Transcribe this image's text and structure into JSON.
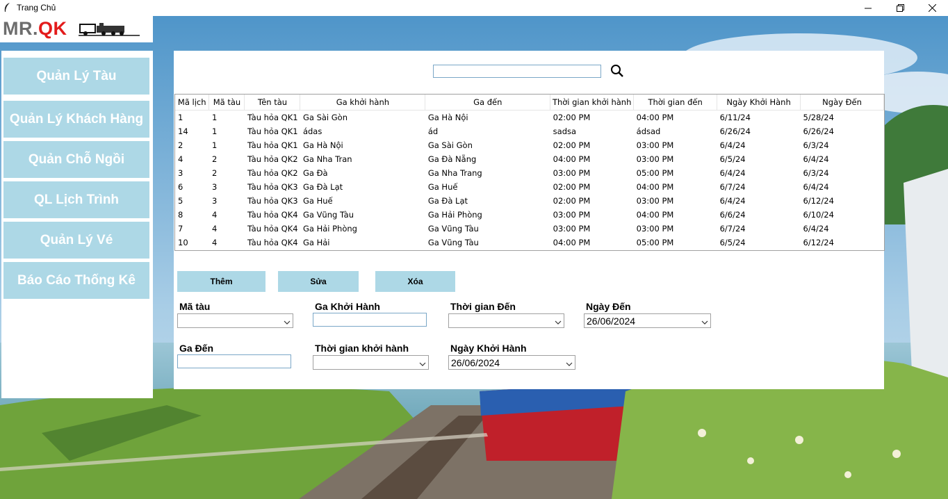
{
  "window": {
    "title": "Trang Chủ"
  },
  "logo": {
    "part1": "MR.",
    "part2": "QK"
  },
  "sidebar": {
    "items": [
      {
        "label": "Quản Lý Tàu"
      },
      {
        "label": "Quản Lý Khách Hàng"
      },
      {
        "label": "Quản Chỗ Ngồi"
      },
      {
        "label": "QL Lịch Trình"
      },
      {
        "label": "Quản Lý Vé"
      },
      {
        "label": "Báo Cáo Thống Kê"
      }
    ]
  },
  "search": {
    "value": "",
    "icon": "search-icon"
  },
  "table": {
    "columns": [
      "Mã lịch",
      "Mã tàu",
      "Tên tàu",
      "Ga khởi hành",
      "Ga đến",
      "Thời gian khởi hành",
      "Thời gian đến",
      "Ngày Khởi Hành",
      "Ngày Đến"
    ],
    "rows": [
      [
        "1",
        "1",
        "Tàu hỏa QK1",
        "Ga Sài Gòn",
        "Ga Hà Nội",
        "02:00 PM",
        "04:00 PM",
        "6/11/24",
        "5/28/24"
      ],
      [
        "14",
        "1",
        "Tàu hỏa QK1",
        "ádas",
        "ád",
        "sadsa",
        "ádsad",
        "6/26/24",
        "6/26/24"
      ],
      [
        "2",
        "1",
        "Tàu hỏa QK1",
        "Ga Hà Nội",
        "Ga Sài Gòn",
        "02:00 PM",
        "03:00 PM",
        "6/4/24",
        "6/3/24"
      ],
      [
        "4",
        "2",
        "Tàu hỏa QK2",
        "Ga Nha Tran",
        "Ga Đà Nẵng",
        "04:00 PM",
        "03:00 PM",
        "6/5/24",
        "6/4/24"
      ],
      [
        "3",
        "2",
        "Tàu hỏa QK2",
        "Ga Đà",
        "Ga Nha Trang",
        "03:00 PM",
        "05:00 PM",
        "6/4/24",
        "6/3/24"
      ],
      [
        "6",
        "3",
        "Tàu hỏa QK3",
        "Ga Đà Lạt",
        "Ga Huế",
        "02:00 PM",
        "04:00 PM",
        "6/7/24",
        "6/4/24"
      ],
      [
        "5",
        "3",
        "Tàu hỏa QK3",
        "Ga Huế",
        "Ga Đà Lạt",
        "02:00 PM",
        "03:00 PM",
        "6/4/24",
        "6/12/24"
      ],
      [
        "8",
        "4",
        "Tàu hỏa QK4",
        "Ga Vũng Tàu",
        "Ga Hải Phòng",
        "03:00 PM",
        "04:00 PM",
        "6/6/24",
        "6/10/24"
      ],
      [
        "7",
        "4",
        "Tàu hỏa QK4",
        "Ga Hải Phòng",
        "Ga Vũng Tàu",
        "03:00 PM",
        "03:00 PM",
        "6/7/24",
        "6/4/24"
      ],
      [
        "10",
        "4",
        "Tàu hỏa QK4",
        "Ga Hải",
        "Ga Vũng Tàu",
        "04:00 PM",
        "05:00 PM",
        "6/5/24",
        "6/12/24"
      ]
    ]
  },
  "actions": {
    "add": "Thêm",
    "edit": "Sửa",
    "delete": "Xóa"
  },
  "form": {
    "ma_tau": {
      "label": "Mã tàu",
      "value": ""
    },
    "ga_khoi_hanh": {
      "label": "Ga Khởi Hành",
      "value": ""
    },
    "thoi_gian_den": {
      "label": "Thời gian Đến",
      "value": ""
    },
    "ngay_den": {
      "label": "Ngày Đến",
      "value": "26/06/2024"
    },
    "ga_den": {
      "label": "Ga Đến",
      "value": ""
    },
    "thoi_gian_khoi_hanh": {
      "label": "Thời gian khởi hành",
      "value": ""
    },
    "ngay_khoi_hanh": {
      "label": "Ngày Khởi Hành",
      "value": "26/06/2024"
    }
  },
  "colors": {
    "button": "#add8e6",
    "logo_red": "#e31b1b",
    "logo_gray": "#6d6d6d"
  }
}
